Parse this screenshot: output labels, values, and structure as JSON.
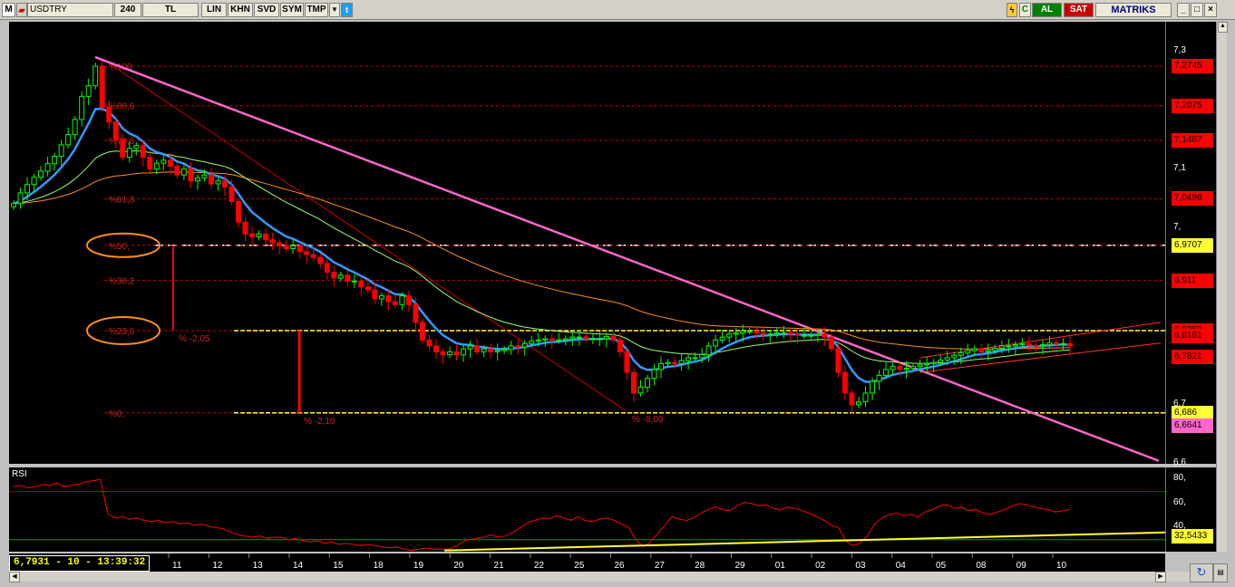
{
  "toolbar": {
    "logo": "M",
    "symbol": "USDTRY",
    "period": "240",
    "currency": "TL",
    "buttons": [
      "LIN",
      "KHN",
      "SVD",
      "SYM",
      "TMP"
    ],
    "buy_label": "AL",
    "sell_label": "SAT",
    "brand": "MATRIKS",
    "window_buttons": [
      "_",
      "□",
      "×"
    ]
  },
  "status": {
    "readout": "6,7931 - 10 - 13:39:32"
  },
  "colors": {
    "up": "#00ff00",
    "down": "#ff0000",
    "ema_fast": "#3399ff",
    "ema_mid": "#99ff66",
    "ema_slow": "#ff8c1a",
    "trendline": "#ff66cc",
    "fib": "#cc0000",
    "band": "#ffff33"
  },
  "chart_data": [
    {
      "type": "line",
      "name": "price",
      "ylim": [
        6.6,
        7.35
      ],
      "y_ticks": [
        "7,3",
        "7,1",
        "7,",
        "6,7",
        "6,6"
      ],
      "y_tick_values": [
        7.3,
        7.1,
        7.0,
        6.7,
        6.6
      ],
      "x_labels": [
        "11",
        "12",
        "13",
        "14",
        "15",
        "18",
        "19",
        "20",
        "21",
        "22",
        "25",
        "26",
        "27",
        "28",
        "29",
        "01",
        "02",
        "03",
        "04",
        "05",
        "08",
        "09",
        "10"
      ],
      "close": [
        7.0414,
        7.0596,
        7.0739,
        7.0862,
        7.0965,
        7.1092,
        7.1217,
        7.1411,
        7.1585,
        7.1841,
        7.2234,
        7.2413,
        7.2745,
        7.205,
        7.18,
        7.15,
        7.12,
        7.135,
        7.14,
        7.12,
        7.1,
        7.11,
        7.115,
        7.105,
        7.09,
        7.1,
        7.08,
        7.085,
        7.09,
        7.075,
        7.08,
        7.07,
        7.045,
        7.01,
        6.99,
        6.985,
        6.99,
        6.98,
        6.975,
        6.97,
        6.965,
        6.97,
        6.96,
        6.955,
        6.95,
        6.94,
        6.925,
        6.915,
        6.92,
        6.91,
        6.91,
        6.9,
        6.895,
        6.88,
        6.885,
        6.875,
        6.87,
        6.885,
        6.87,
        6.84,
        6.81,
        6.8,
        6.79,
        6.785,
        6.79,
        6.785,
        6.795,
        6.8,
        6.79,
        6.795,
        6.79,
        6.792,
        6.794,
        6.8,
        6.798,
        6.804,
        6.808,
        6.81,
        6.812,
        6.81,
        6.81,
        6.812,
        6.815,
        6.815,
        6.812,
        6.812,
        6.812,
        6.816,
        6.81,
        6.79,
        6.755,
        6.72,
        6.73,
        6.745,
        6.76,
        6.77,
        6.772,
        6.77,
        6.775,
        6.78,
        6.78,
        6.785,
        6.8,
        6.81,
        6.815,
        6.82,
        6.822,
        6.825,
        6.825,
        6.822,
        6.82,
        6.82,
        6.822,
        6.822,
        6.82,
        6.818,
        6.818,
        6.818,
        6.82,
        6.815,
        6.795,
        6.755,
        6.72,
        6.7,
        6.705,
        6.72,
        6.74,
        6.75,
        6.76,
        6.765,
        6.76,
        6.762,
        6.765,
        6.768,
        6.77,
        6.772,
        6.776,
        6.78,
        6.784,
        6.788,
        6.792,
        6.795,
        6.79,
        6.792,
        6.796,
        6.8,
        6.8,
        6.802,
        6.804,
        6.801,
        6.8,
        6.802,
        6.805,
        6.804,
        6.804,
        6.8
      ]
    },
    {
      "type": "table",
      "name": "fibonacci",
      "levels": [
        "%100",
        "%88,6",
        "%78,6",
        "%61,8",
        "%50,",
        "%38,2",
        "%23,6",
        "%0,"
      ],
      "values": [
        7.2745,
        7.2075,
        7.1487,
        7.0498,
        6.9707,
        6.911,
        6.8259,
        6.6864
      ],
      "moves": [
        "% -2,05",
        "% -2,10",
        "% -8,09"
      ]
    },
    {
      "type": "table",
      "name": "price_boxes",
      "labels": [
        "7,2745",
        "7,2075",
        "7,1487",
        "7,0498",
        "6,9707",
        "6,911",
        "6,8259",
        "6,8161",
        "6,7821",
        "6,686",
        "6,6641"
      ],
      "values": [
        7.2745,
        7.2075,
        7.1487,
        7.0498,
        6.9707,
        6.911,
        6.8259,
        6.8161,
        6.7821,
        6.686,
        6.6641
      ],
      "bg": [
        "#ff0000",
        "#ff0000",
        "#ff0000",
        "#ff0000",
        "#ffff33",
        "#ff0000",
        "#ff0000",
        "#ff0000",
        "#ff0000",
        "#ffff33",
        "#ff66cc"
      ],
      "extra_label": "6,9707"
    },
    {
      "type": "line",
      "name": "RSI",
      "title": "RSI",
      "ylim": [
        20,
        90
      ],
      "y_ticks": [
        "80,",
        "60,",
        "40,"
      ],
      "y_tick_values": [
        80,
        60,
        40
      ],
      "current_label": "32,5433",
      "current_value": 32.5433,
      "values": [
        74,
        75,
        73,
        74,
        76,
        75,
        77,
        74,
        75,
        76,
        78,
        79,
        80,
        52,
        48,
        49,
        47,
        48,
        46,
        45,
        46,
        44,
        45,
        43,
        44,
        42,
        43,
        41,
        40,
        39,
        36,
        34,
        33,
        32,
        33,
        31,
        32,
        32,
        30,
        31,
        29,
        28,
        29,
        27,
        28,
        26,
        27,
        26,
        25,
        26,
        25,
        24,
        23,
        24,
        22,
        21,
        22,
        23,
        22,
        22,
        22,
        24,
        28,
        30,
        31,
        32,
        34,
        32,
        33,
        36,
        40,
        44,
        46,
        48,
        47,
        50,
        48,
        46,
        49,
        46,
        45,
        47,
        48,
        46,
        43,
        40,
        30,
        24,
        28,
        35,
        42,
        49,
        47,
        46,
        48,
        52,
        55,
        57,
        55,
        54,
        58,
        61,
        60,
        58,
        59,
        56,
        55,
        57,
        56,
        54,
        52,
        49,
        46,
        42,
        40,
        29,
        25,
        27,
        33,
        43,
        48,
        51,
        52,
        50,
        51,
        49,
        53,
        55,
        58,
        59,
        56,
        57,
        54,
        55,
        52,
        51,
        53,
        55,
        58,
        60,
        59,
        57,
        56,
        55,
        53,
        54,
        55
      ]
    }
  ]
}
